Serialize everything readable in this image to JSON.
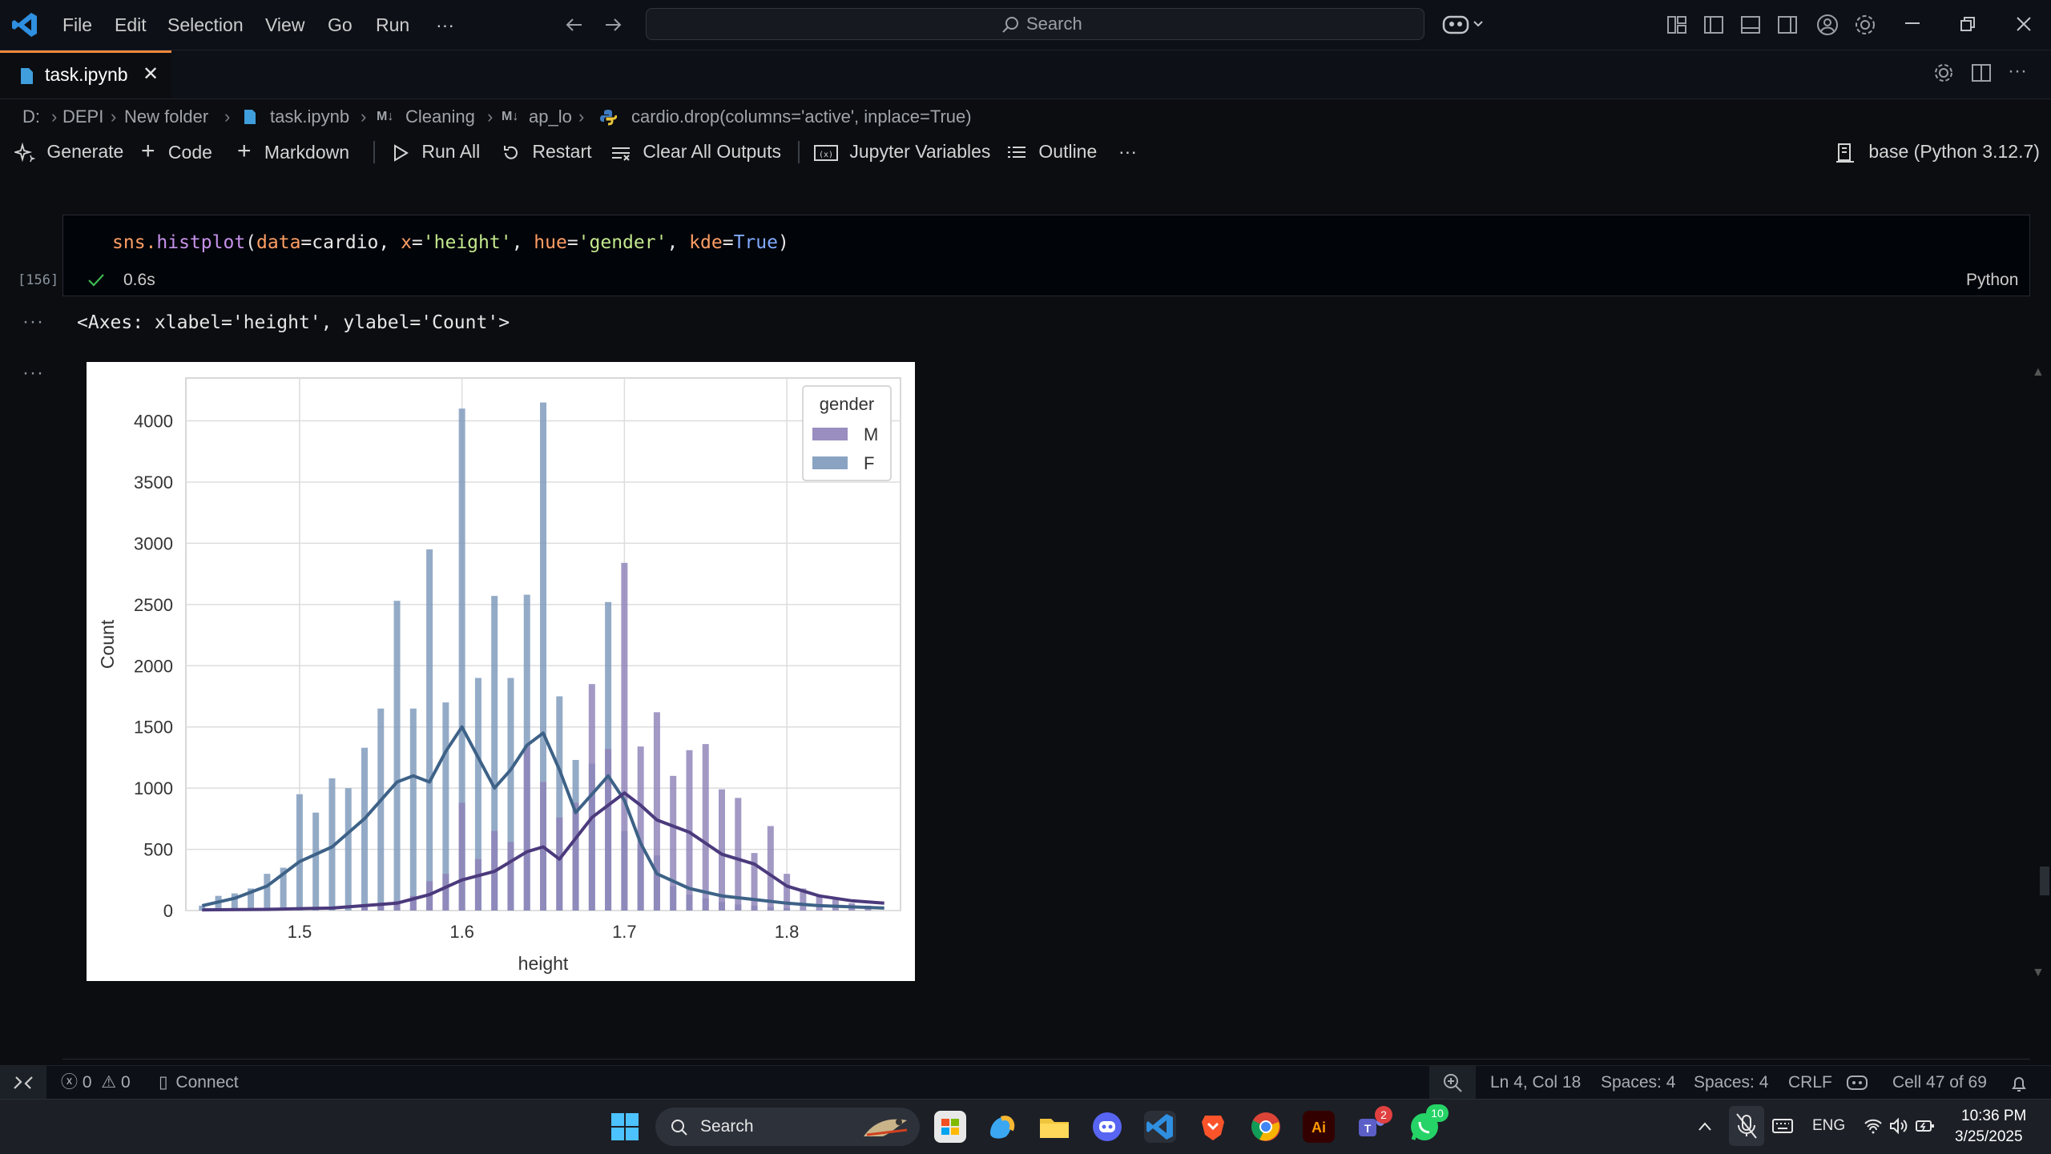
{
  "menu": [
    "File",
    "Edit",
    "Selection",
    "View",
    "Go",
    "Run",
    "···"
  ],
  "search_placeholder": "Search",
  "tab": {
    "label": "task.ipynb",
    "close": "✕"
  },
  "breadcrumb": [
    "D:",
    "DEPI",
    "New folder",
    "task.ipynb",
    "Cleaning",
    "ap_lo",
    "cardio.drop(columns='active', inplace=True)"
  ],
  "toolbar": {
    "generate": "Generate",
    "code": "Code",
    "markdown": "Markdown",
    "run_all": "Run All",
    "restart": "Restart",
    "clear_outputs": "Clear All Outputs",
    "variables": "Jupyter Variables",
    "outline": "Outline",
    "more": "···",
    "kernel": "base (Python 3.12.7)"
  },
  "cell": {
    "code": {
      "fn": "sns.",
      "method": "histplot",
      "open": "(",
      "k1": "data",
      "eq": "=",
      "v1": "cardio, ",
      "k2": "x",
      "v2": "'height'",
      "comma": ", ",
      "k3": "hue",
      "v3": "'gender'",
      "k4": "kde",
      "v4": "True",
      "close": ")"
    },
    "exec_count": "[156]",
    "exec_time": "0.6s",
    "language": "Python",
    "output_text": "<Axes: xlabel='height', ylabel='Count'>",
    "dots": "···"
  },
  "chart_data": {
    "type": "bar",
    "xlabel": "height",
    "ylabel": "Count",
    "xlim": [
      1.43,
      1.87
    ],
    "ylim": [
      0,
      4350
    ],
    "xticks": [
      "1.5",
      "1.6",
      "1.7",
      "1.8"
    ],
    "yticks": [
      "0",
      "500",
      "1000",
      "1500",
      "2000",
      "2500",
      "3000",
      "3500",
      "4000"
    ],
    "grid": true,
    "legend_title": "gender",
    "legend_position": "top-right",
    "colors": {
      "M": "#8e82b8",
      "F": "#7d99bb",
      "M_line": "#4b3a7c",
      "F_line": "#3e6287"
    },
    "series": [
      {
        "name": "F",
        "x": [
          1.44,
          1.45,
          1.46,
          1.47,
          1.48,
          1.49,
          1.5,
          1.51,
          1.52,
          1.53,
          1.54,
          1.55,
          1.56,
          1.57,
          1.58,
          1.59,
          1.6,
          1.61,
          1.62,
          1.63,
          1.64,
          1.65,
          1.66,
          1.67,
          1.68,
          1.69,
          1.7,
          1.71,
          1.72,
          1.73,
          1.74,
          1.75,
          1.76,
          1.77,
          1.78,
          1.79,
          1.8
        ],
        "values": [
          40,
          120,
          140,
          180,
          300,
          350,
          950,
          800,
          1080,
          1000,
          1330,
          1650,
          2530,
          1650,
          2950,
          1700,
          4100,
          1900,
          2570,
          1900,
          2580,
          4150,
          1750,
          1230,
          1200,
          2520,
          650,
          540,
          450,
          200,
          130,
          100,
          70,
          50,
          40,
          30,
          20
        ]
      },
      {
        "name": "M",
        "x": [
          1.54,
          1.55,
          1.56,
          1.57,
          1.58,
          1.59,
          1.6,
          1.61,
          1.62,
          1.63,
          1.64,
          1.65,
          1.66,
          1.67,
          1.68,
          1.69,
          1.7,
          1.71,
          1.72,
          1.73,
          1.74,
          1.75,
          1.76,
          1.77,
          1.78,
          1.79,
          1.8,
          1.81,
          1.82,
          1.83,
          1.84,
          1.85
        ],
        "values": [
          30,
          60,
          80,
          120,
          240,
          300,
          880,
          420,
          650,
          560,
          1350,
          1050,
          760,
          880,
          1850,
          1320,
          2840,
          1340,
          1620,
          1100,
          1310,
          1360,
          990,
          920,
          470,
          690,
          300,
          180,
          120,
          90,
          60,
          40
        ]
      }
    ],
    "kde": [
      {
        "name": "F",
        "x": [
          1.44,
          1.46,
          1.48,
          1.5,
          1.52,
          1.54,
          1.56,
          1.57,
          1.58,
          1.59,
          1.6,
          1.61,
          1.62,
          1.63,
          1.64,
          1.65,
          1.66,
          1.67,
          1.68,
          1.69,
          1.7,
          1.71,
          1.72,
          1.74,
          1.76,
          1.78,
          1.8,
          1.82,
          1.84,
          1.86
        ],
        "values": [
          40,
          100,
          200,
          400,
          520,
          750,
          1050,
          1100,
          1050,
          1300,
          1500,
          1250,
          1000,
          1150,
          1350,
          1450,
          1150,
          800,
          950,
          1100,
          900,
          550,
          300,
          180,
          120,
          90,
          60,
          40,
          30,
          20
        ]
      },
      {
        "name": "M",
        "x": [
          1.44,
          1.48,
          1.52,
          1.56,
          1.58,
          1.6,
          1.62,
          1.64,
          1.65,
          1.66,
          1.68,
          1.69,
          1.7,
          1.71,
          1.72,
          1.74,
          1.76,
          1.78,
          1.8,
          1.82,
          1.84,
          1.86
        ],
        "values": [
          5,
          10,
          20,
          60,
          130,
          250,
          320,
          480,
          520,
          420,
          760,
          860,
          960,
          860,
          740,
          640,
          460,
          380,
          200,
          120,
          80,
          60
        ]
      }
    ]
  },
  "status": {
    "errors": "0",
    "warnings": "0",
    "connect": "Connect",
    "position": "Ln 4, Col 18",
    "spaces1": "Spaces: 4",
    "spaces2": "Spaces: 4",
    "eol": "CRLF",
    "cell_pos": "Cell 47 of 69"
  },
  "taskbar": {
    "search": "Search",
    "lang": "ENG",
    "time": "10:36 PM",
    "date": "3/25/2025",
    "teams_badge": "2",
    "whatsapp_badge": "10"
  }
}
